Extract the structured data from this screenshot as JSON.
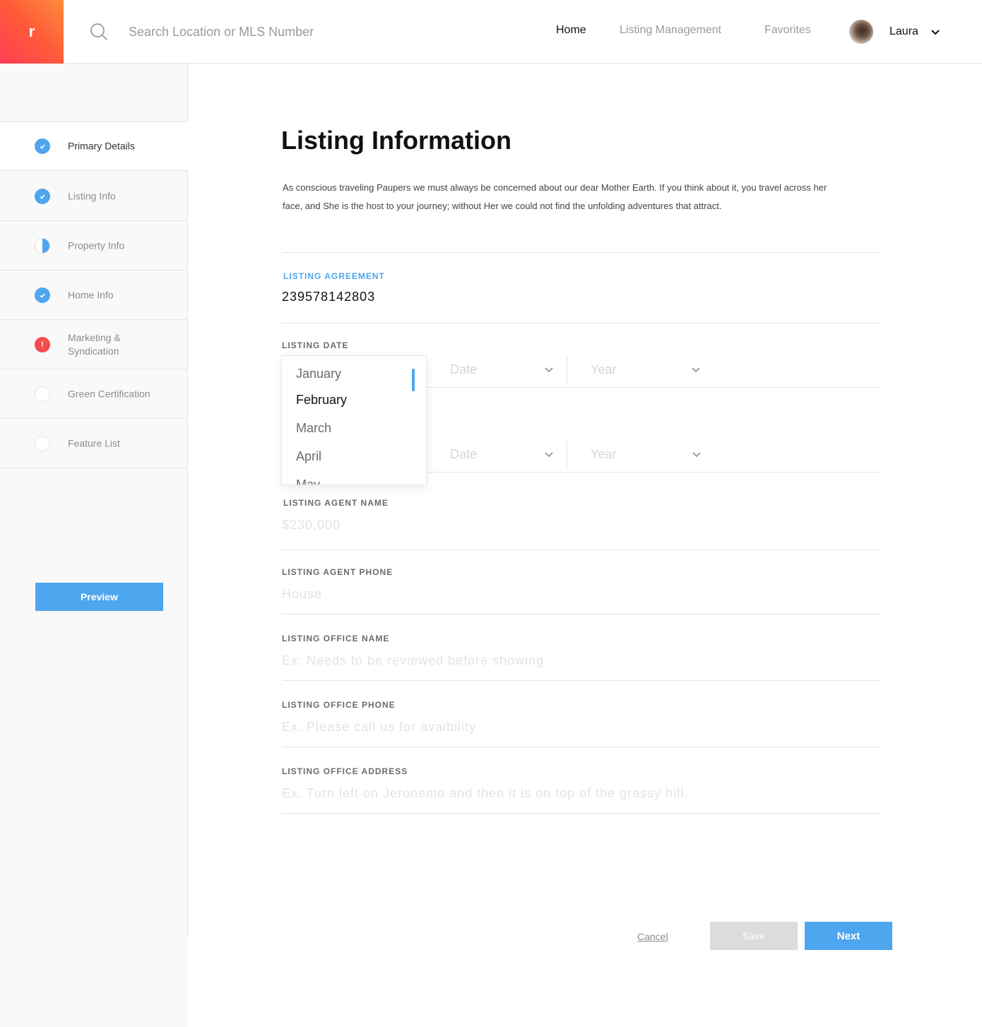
{
  "header": {
    "logo_text": "r",
    "search_placeholder": "Search Location or MLS Number",
    "nav": [
      {
        "label": "Home",
        "active": true
      },
      {
        "label": "Listing Management",
        "active": false
      },
      {
        "label": "Favorites",
        "active": false
      }
    ],
    "user_name": "Laura"
  },
  "sidebar": {
    "steps": [
      {
        "label": "Primary Details",
        "status": "complete",
        "active": true
      },
      {
        "label": "Listing Info",
        "status": "complete",
        "active": false
      },
      {
        "label": "Property Info",
        "status": "partial",
        "active": false
      },
      {
        "label": "Home Info",
        "status": "complete",
        "active": false
      },
      {
        "label": "Marketing & Syndication",
        "status": "error",
        "active": false
      },
      {
        "label": "Green Certification",
        "status": "empty",
        "active": false
      },
      {
        "label": "Feature List",
        "status": "empty",
        "active": false
      }
    ],
    "error_glyph": "!",
    "preview_label": "Preview"
  },
  "main": {
    "title": "Listing Information",
    "intro": "As conscious traveling Paupers we must always be concerned about our dear Mother Earth. If you think about it, you travel across her face, and She is the host to your journey; without Her we could not find the unfolding adventures that attract.",
    "listing_agreement": {
      "label": "LISTING AGREEMENT",
      "value": "239578142803"
    },
    "listing_date": {
      "label": "LISTING DATE",
      "date_placeholder": "Date",
      "year_placeholder": "Year"
    },
    "second_date": {
      "date_placeholder": "Date",
      "year_placeholder": "Year"
    },
    "month_dropdown": {
      "options": [
        "January",
        "February",
        "March",
        "April",
        "May"
      ],
      "selected": "February"
    },
    "fields": [
      {
        "label": "LISTING AGENT NAME",
        "placeholder": "$230,000"
      },
      {
        "label": "LISTING AGENT PHONE",
        "placeholder": "House"
      },
      {
        "label": "LISTING OFFICE NAME",
        "placeholder": "Ex. Needs to be reviewed before showing"
      },
      {
        "label": "LISTING OFFICE PHONE",
        "placeholder": "Ex. Please call us for avaibility"
      },
      {
        "label": "LISTING OFFICE ADDRESS",
        "placeholder": "Ex. Turn left on Jeronemo and then it is on top of the grassy hill."
      }
    ]
  },
  "actions": {
    "cancel_label": "Cancel",
    "save_label": "Save",
    "next_label": "Next"
  },
  "colors": {
    "accent": "#4ea6ee",
    "error": "#f44b4b",
    "logo_gradient_start": "#ff3d55",
    "logo_gradient_end": "#ff8a3a"
  }
}
